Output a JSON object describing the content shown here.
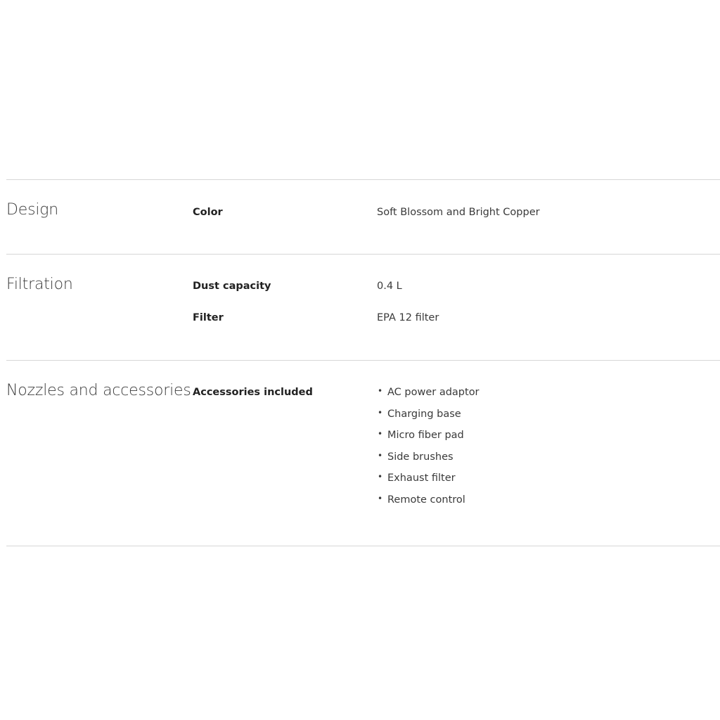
{
  "sections": [
    {
      "title": "Design",
      "rows": [
        {
          "label": "Color",
          "value": "Soft Blossom and Bright Copper"
        }
      ]
    },
    {
      "title": "Filtration",
      "rows": [
        {
          "label": "Dust capacity",
          "value": "0.4  L"
        },
        {
          "label": "Filter",
          "value": "EPA 12 filter"
        }
      ]
    },
    {
      "title": "Nozzles and accessories",
      "rows": [
        {
          "label": "Accessories included",
          "items": [
            "AC power adaptor",
            "Charging base",
            "Micro fiber pad",
            "Side brushes",
            "Exhaust filter",
            "Remote control"
          ]
        }
      ]
    }
  ],
  "bullet_glyph": "•"
}
